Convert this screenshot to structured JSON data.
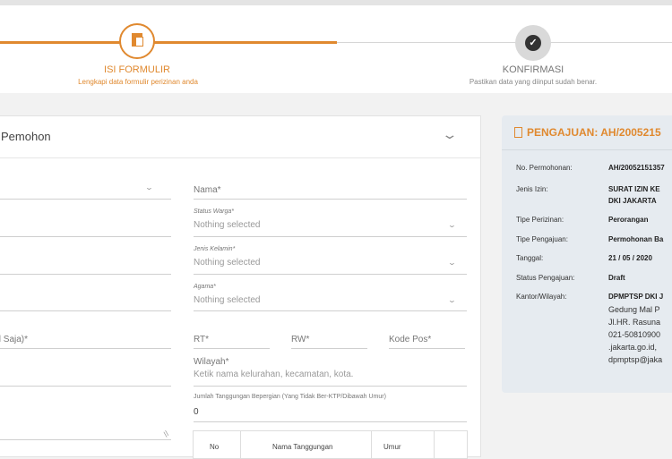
{
  "steps": [
    {
      "title": "ISI FORMULIR",
      "subtitle": "Lengkapi data formulir perizinan anda",
      "icon": "document-icon"
    },
    {
      "title": "KONFIRMASI",
      "subtitle": "Pastikan data yang diinput sudah benar.",
      "icon": "check-icon"
    }
  ],
  "form": {
    "section_title": "Pemohon",
    "left_fields": [
      {
        "label": ""
      },
      {
        "label": ""
      },
      {
        "label": ""
      },
      {
        "label": ""
      },
      {
        "label": "ail Saja)*"
      },
      {
        "label": ""
      }
    ],
    "nama": {
      "label": "Nama*"
    },
    "status_warga": {
      "label": "Status Warga*",
      "value": "Nothing selected"
    },
    "jenis_kelamin": {
      "label": "Jenis Kelamin*",
      "value": "Nothing selected"
    },
    "agama": {
      "label": "Agama*",
      "value": "Nothing selected"
    },
    "rt": {
      "label": "RT*"
    },
    "rw": {
      "label": "RW*"
    },
    "kode_pos": {
      "label": "Kode Pos*"
    },
    "wilayah": {
      "label": "Wilayah*",
      "placeholder": "Ketik nama kelurahan, kecamatan, kota."
    },
    "tanggungan": {
      "label": "Jumlah Tanggungan Bepergian (Yang Tidak Ber-KTP/Dibawah Umur)",
      "value": "0"
    },
    "table_headers": [
      "No",
      "Nama Tanggungan",
      "Umur"
    ]
  },
  "sidebar": {
    "title": "PENGAJUAN: AH/2005215",
    "rows": [
      {
        "key": "No. Permohonan:",
        "value": "AH/20052151357"
      },
      {
        "key": "Jenis Izin:",
        "value": "SURAT IZIN KE",
        "value2": "DKI JAKARTA"
      },
      {
        "key": "Tipe Perizinan:",
        "value": "Perorangan"
      },
      {
        "key": "Tipe Pengajuan:",
        "value": "Permohonan Ba"
      },
      {
        "key": "Tanggal:",
        "value": "21 / 05 / 2020"
      },
      {
        "key": "Status Pengajuan:",
        "value": "Draft"
      },
      {
        "key": "Kantor/Wilayah:",
        "value": "DPMPTSP DKI J"
      }
    ],
    "address_lines": [
      "Gedung Mal P",
      "Jl.HR. Rasuna",
      "021-50810900",
      ".jakarta.go.id,",
      "dpmptsp@jaka"
    ]
  }
}
